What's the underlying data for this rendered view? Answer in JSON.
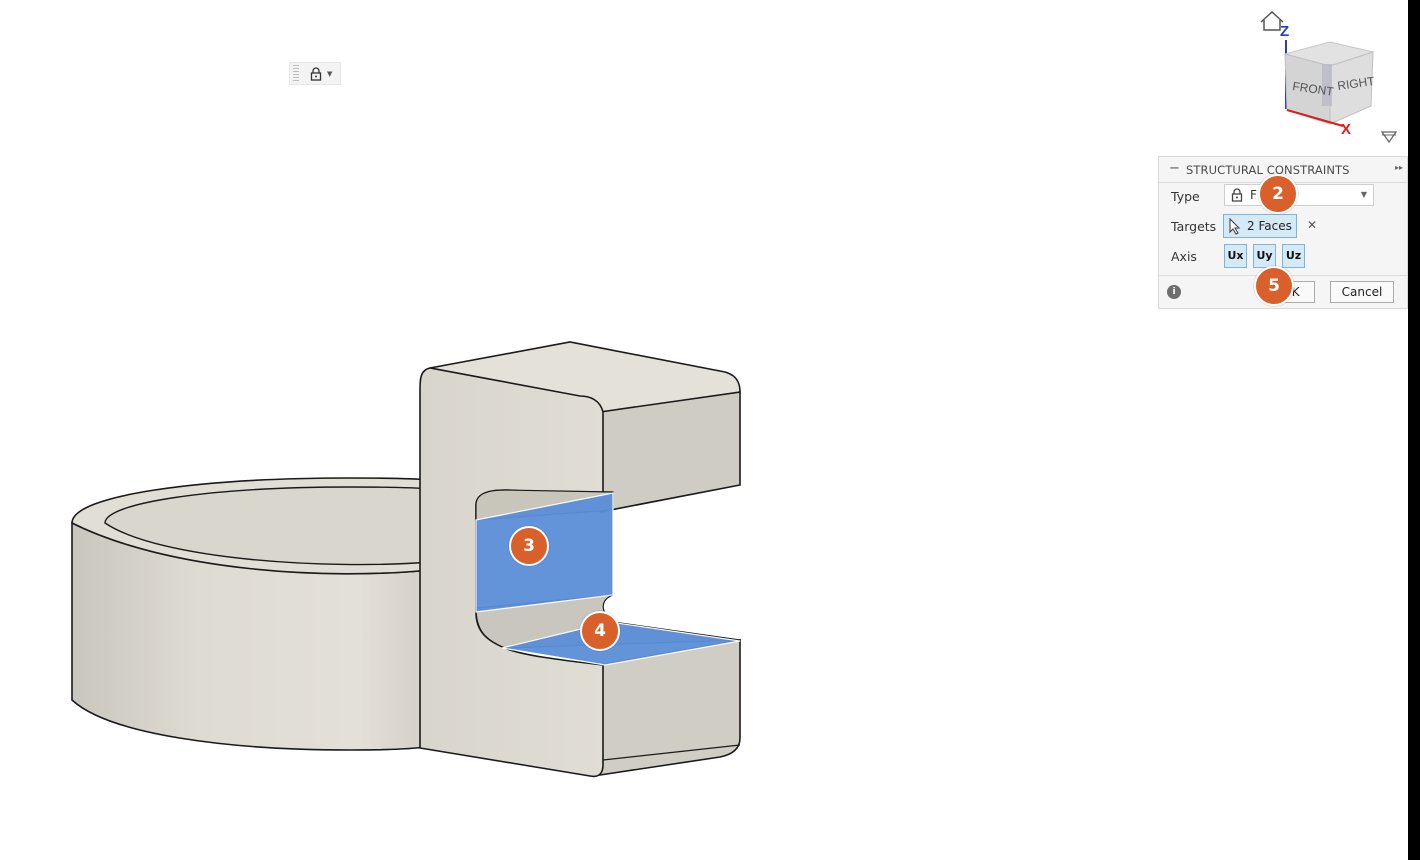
{
  "toolbar": {
    "lock_icon": "lock-icon",
    "dropdown_icon": "caret-down-icon"
  },
  "viewcube": {
    "home_icon": "home-icon",
    "axis_z": "Z",
    "axis_x": "X",
    "face_front": "FRONT",
    "face_right": "RIGHT"
  },
  "dialog": {
    "title": "STRUCTURAL CONSTRAINTS",
    "type_label": "Type",
    "type_value": "F",
    "targets_label": "Targets",
    "targets_value": "2 Faces",
    "axis_label": "Axis",
    "axis_buttons": [
      "Ux",
      "Uy",
      "Uz"
    ],
    "ok_label": "OK",
    "cancel_label": "Cancel",
    "info_glyph": "i",
    "clear_glyph": "✕",
    "collapse_glyph": "−",
    "expand_glyph": "▸▸"
  },
  "callouts": [
    "2",
    "3",
    "4",
    "5"
  ],
  "colors": {
    "callout": "#d95f2b",
    "selected_face": "#5b8fd9",
    "model_body": "#d8d5cc",
    "toggle_active": "#d5eaf6"
  }
}
